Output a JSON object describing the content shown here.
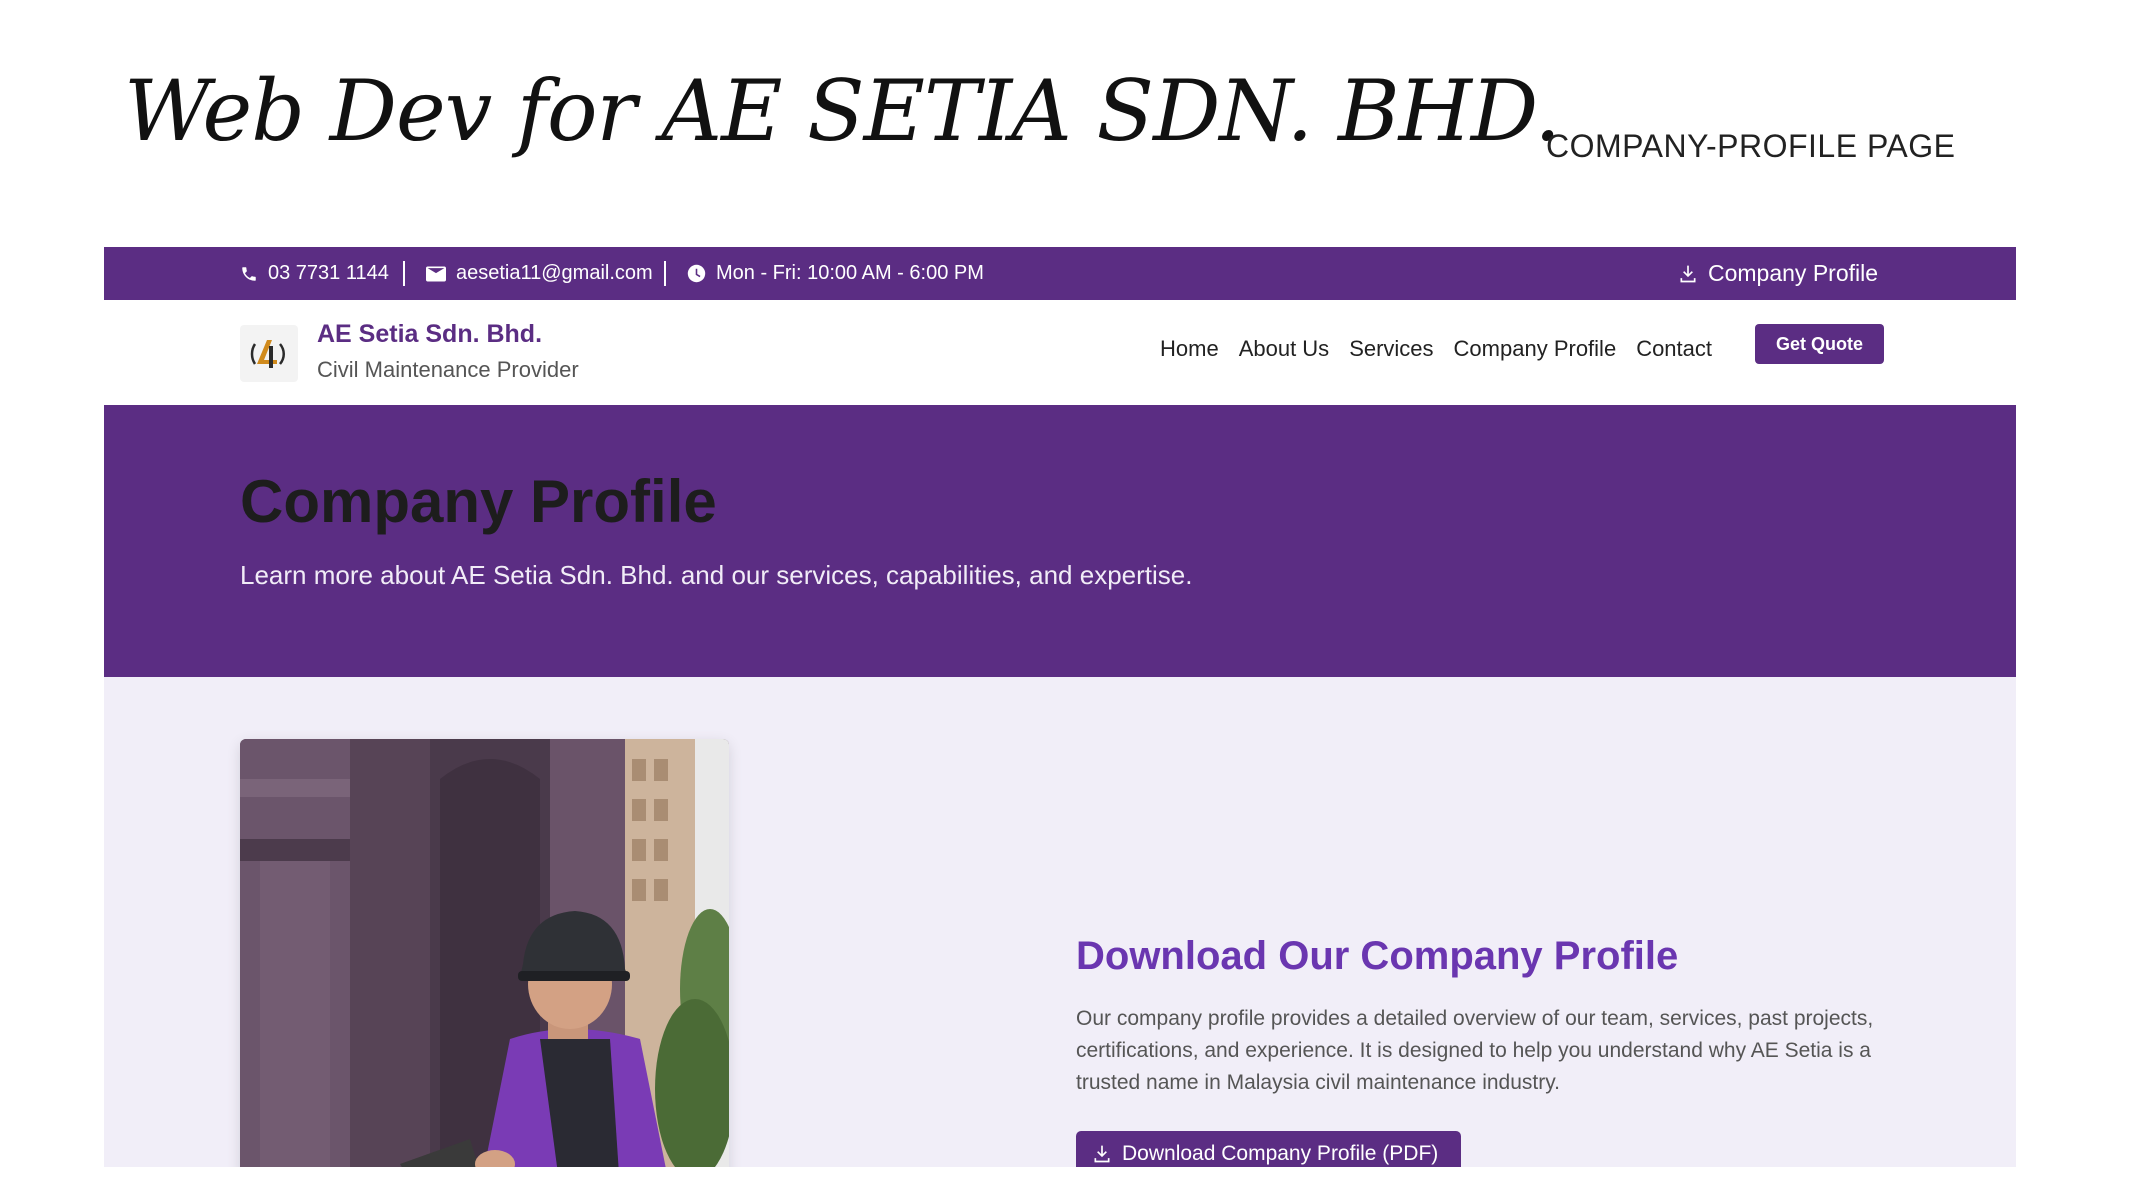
{
  "slide": {
    "title": "Web Dev for AE SETIA SDN. BHD.",
    "subtitle": "COMPANY-PROFILE PAGE"
  },
  "topbar": {
    "phone": "03 7731 1144",
    "email": "aesetia11@gmail.com",
    "hours": "Mon - Fri: 10:00 AM - 6:00 PM",
    "profile_link": "Company Profile"
  },
  "brand": {
    "name": "AE Setia Sdn. Bhd.",
    "tagline": "Civil Maintenance Provider"
  },
  "nav": {
    "links": [
      "Home",
      "About Us",
      "Services",
      "Company Profile",
      "Contact"
    ],
    "cta": "Get Quote"
  },
  "hero": {
    "title": "Company Profile",
    "subtitle": "Learn more about AE Setia Sdn. Bhd. and our services, capabilities, and expertise."
  },
  "download": {
    "title": "Download Our Company Profile",
    "text": "Our company profile provides a detailed overview of our team, services, past projects, certifications, and experience. It is designed to help you understand why AE Setia is a trusted name in Malaysia civil maintenance industry.",
    "button": "Download Company Profile (PDF)"
  },
  "colors": {
    "brand_purple": "#5b2d83",
    "heading_purple": "#6a36b0",
    "page_bg": "#f1eef8"
  }
}
